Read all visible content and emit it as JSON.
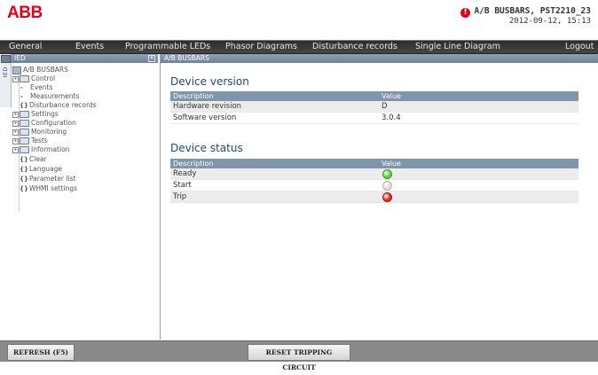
{
  "header": {
    "logo": "ABB",
    "alarm_icon": "!",
    "device_name": "A/B BUSBARS, PST2210_23",
    "datetime": "2012-09-12, 15:13"
  },
  "menu": {
    "items": [
      "General",
      "Events",
      "Programmable LEDs",
      "Phasor Diagrams",
      "Disturbance records",
      "Single Line Diagram"
    ],
    "logout": "Logout"
  },
  "left_panel": {
    "title": "IED",
    "close": "✕",
    "side_tab": "IED",
    "tree": [
      {
        "label": "A/B BUSBARS",
        "icon": "device-icon"
      },
      {
        "label": "Control",
        "icon": "folder-icon"
      },
      {
        "label": "Events",
        "icon": "waveform-icon"
      },
      {
        "label": "Measurements",
        "icon": "waveform-icon"
      },
      {
        "label": "Disturbance records",
        "icon": "parameter-icon"
      },
      {
        "label": "Settings",
        "icon": "folder-icon"
      },
      {
        "label": "Configuration",
        "icon": "folder-icon"
      },
      {
        "label": "Monitoring",
        "icon": "folder-icon"
      },
      {
        "label": "Tests",
        "icon": "folder-icon"
      },
      {
        "label": "Information",
        "icon": "folder-icon"
      },
      {
        "label": "Clear",
        "icon": "parameter-icon"
      },
      {
        "label": "Language",
        "icon": "parameter-icon"
      },
      {
        "label": "Parameter list",
        "icon": "parameter-icon"
      },
      {
        "label": "WHMI settings",
        "icon": "parameter-icon"
      }
    ]
  },
  "content": {
    "breadcrumb": "A/B BUSBARS",
    "version": {
      "title": "Device version",
      "col_desc": "Description",
      "col_value": "Value",
      "rows": [
        {
          "desc": "Hardware revision",
          "value": "D"
        },
        {
          "desc": "Software version",
          "value": "3.0.4"
        }
      ]
    },
    "status": {
      "title": "Device status",
      "col_desc": "Description",
      "col_value": "Value",
      "rows": [
        {
          "desc": "Ready",
          "state": "green",
          "color": "#5ccf3a"
        },
        {
          "desc": "Start",
          "state": "off",
          "color": "#dcdcdc"
        },
        {
          "desc": "Trip",
          "state": "red",
          "color": "#e8241a"
        }
      ]
    }
  },
  "footer": {
    "refresh": "REFRESH (F5)",
    "reset": "RESET TRIPPING CIRCUIT"
  },
  "colors": {
    "brand": "#e2001a",
    "menubar": "#3a3a3a",
    "table_header": "#7f95ab",
    "section_title": "#1e4a72"
  }
}
